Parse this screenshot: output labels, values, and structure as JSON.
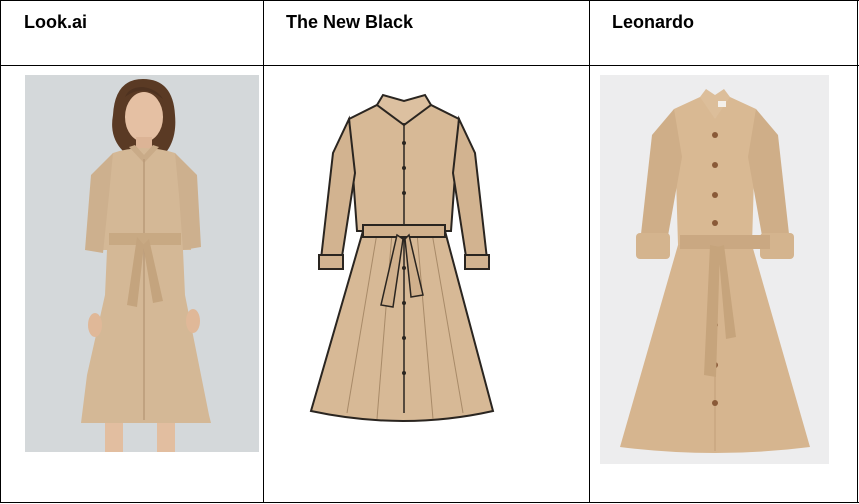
{
  "table": {
    "columns": [
      {
        "header": "Look.ai",
        "image": "woman-wearing-beige-belted-shirt-dress-photo"
      },
      {
        "header": "The New Black",
        "image": "beige-belted-shirt-dress-flat-sketch"
      },
      {
        "header": "Leonardo",
        "image": "beige-belted-shirt-dress-product-render"
      }
    ]
  },
  "colors": {
    "dress": "#d7b896",
    "dress_shade": "#c4a27c",
    "render_bg": "#ececec",
    "photo_bg": "#d7dadc",
    "outline": "#2a2520"
  }
}
